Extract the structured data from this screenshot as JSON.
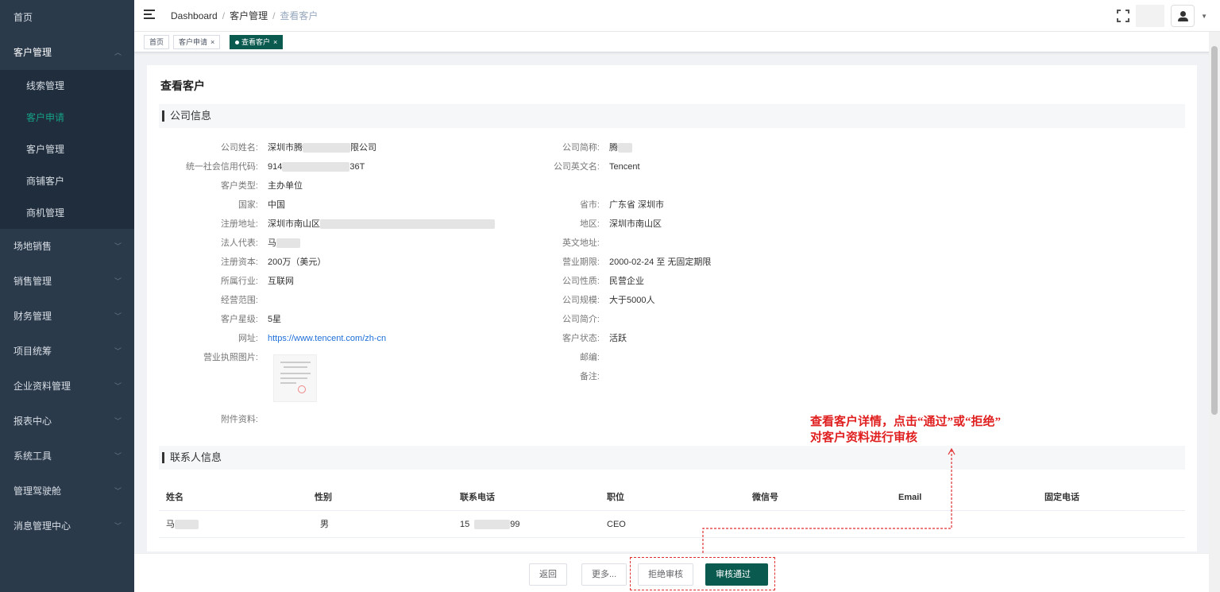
{
  "sidebar": {
    "items": [
      {
        "label": "首页"
      },
      {
        "label": "客户管理",
        "open": true
      },
      {
        "label": "场地销售"
      },
      {
        "label": "销售管理"
      },
      {
        "label": "财务管理"
      },
      {
        "label": "项目统筹"
      },
      {
        "label": "企业资料管理"
      },
      {
        "label": "报表中心"
      },
      {
        "label": "系统工具"
      },
      {
        "label": "管理驾驶舱"
      },
      {
        "label": "消息管理中心"
      }
    ],
    "subitems": [
      {
        "label": "线索管理"
      },
      {
        "label": "客户申请",
        "active": true
      },
      {
        "label": "客户管理"
      },
      {
        "label": "商铺客户"
      },
      {
        "label": "商机管理"
      }
    ]
  },
  "breadcrumb": {
    "root": "Dashboard",
    "mid": "客户管理",
    "current": "查看客户",
    "sep": "/"
  },
  "tags": [
    {
      "label": "首页"
    },
    {
      "label": "客户申请",
      "close": "×"
    },
    {
      "label": "查看客户",
      "close": "×",
      "active": true
    }
  ],
  "page": {
    "title": "查看客户"
  },
  "company": {
    "section_title": "公司信息",
    "left": [
      {
        "label": "公司姓名:",
        "value": "深圳市腾",
        "value2": "限公司"
      },
      {
        "label": "统一社会信用代码:",
        "value": "914",
        "value2": "36T"
      },
      {
        "label": "客户类型:",
        "value": "主办单位"
      },
      {
        "label": "国家:",
        "value": "中国"
      },
      {
        "label": "注册地址:",
        "value": "深圳市南山区"
      },
      {
        "label": "法人代表:",
        "value": "马"
      },
      {
        "label": "注册资本:",
        "value": "200万（美元）"
      },
      {
        "label": "所属行业:",
        "value": "互联网"
      },
      {
        "label": "经营范围:",
        "value": ""
      },
      {
        "label": "客户星级:",
        "value": "5星"
      },
      {
        "label": "网址:",
        "value": "https://www.tencent.com/zh-cn"
      },
      {
        "label": "营业执照图片:",
        "value": ""
      },
      {
        "label": "附件资料:",
        "value": ""
      }
    ],
    "right": [
      {
        "label": "公司简称:",
        "value": "腾"
      },
      {
        "label": "公司英文名:",
        "value": "Tencent"
      },
      {
        "label": "省市:",
        "value": "广东省 深圳市"
      },
      {
        "label": "地区:",
        "value": "深圳市南山区"
      },
      {
        "label": "英文地址:",
        "value": ""
      },
      {
        "label": "营业期限:",
        "value": "2000-02-24 至 无固定期限"
      },
      {
        "label": "公司性质:",
        "value": "民营企业"
      },
      {
        "label": "公司规模:",
        "value": "大于5000人"
      },
      {
        "label": "公司简介:",
        "value": ""
      },
      {
        "label": "客户状态:",
        "value": "活跃"
      },
      {
        "label": "邮编:",
        "value": ""
      },
      {
        "label": "备注:",
        "value": ""
      }
    ]
  },
  "contacts": {
    "section_title": "联系人信息",
    "columns": [
      "姓名",
      "性别",
      "联系电话",
      "职位",
      "微信号",
      "Email",
      "固定电话"
    ],
    "rows": [
      {
        "name": "马",
        "gender": "男",
        "phone": "15",
        "phone2": "99",
        "title": "CEO",
        "wechat": "",
        "email": "",
        "tel": ""
      }
    ]
  },
  "actions": {
    "back": "返回",
    "more": "更多...",
    "reject": "拒绝审核",
    "approve": "审核通过"
  },
  "annotation": {
    "line1": "查看客户详情，点击“通过”或“拒绝”",
    "line2": "对客户资料进行审核"
  },
  "colors": {
    "accent": "#0b5a4f",
    "active_menu": "#16a085",
    "annotation": "#e02020",
    "sidebar": "#2b3a4b"
  }
}
